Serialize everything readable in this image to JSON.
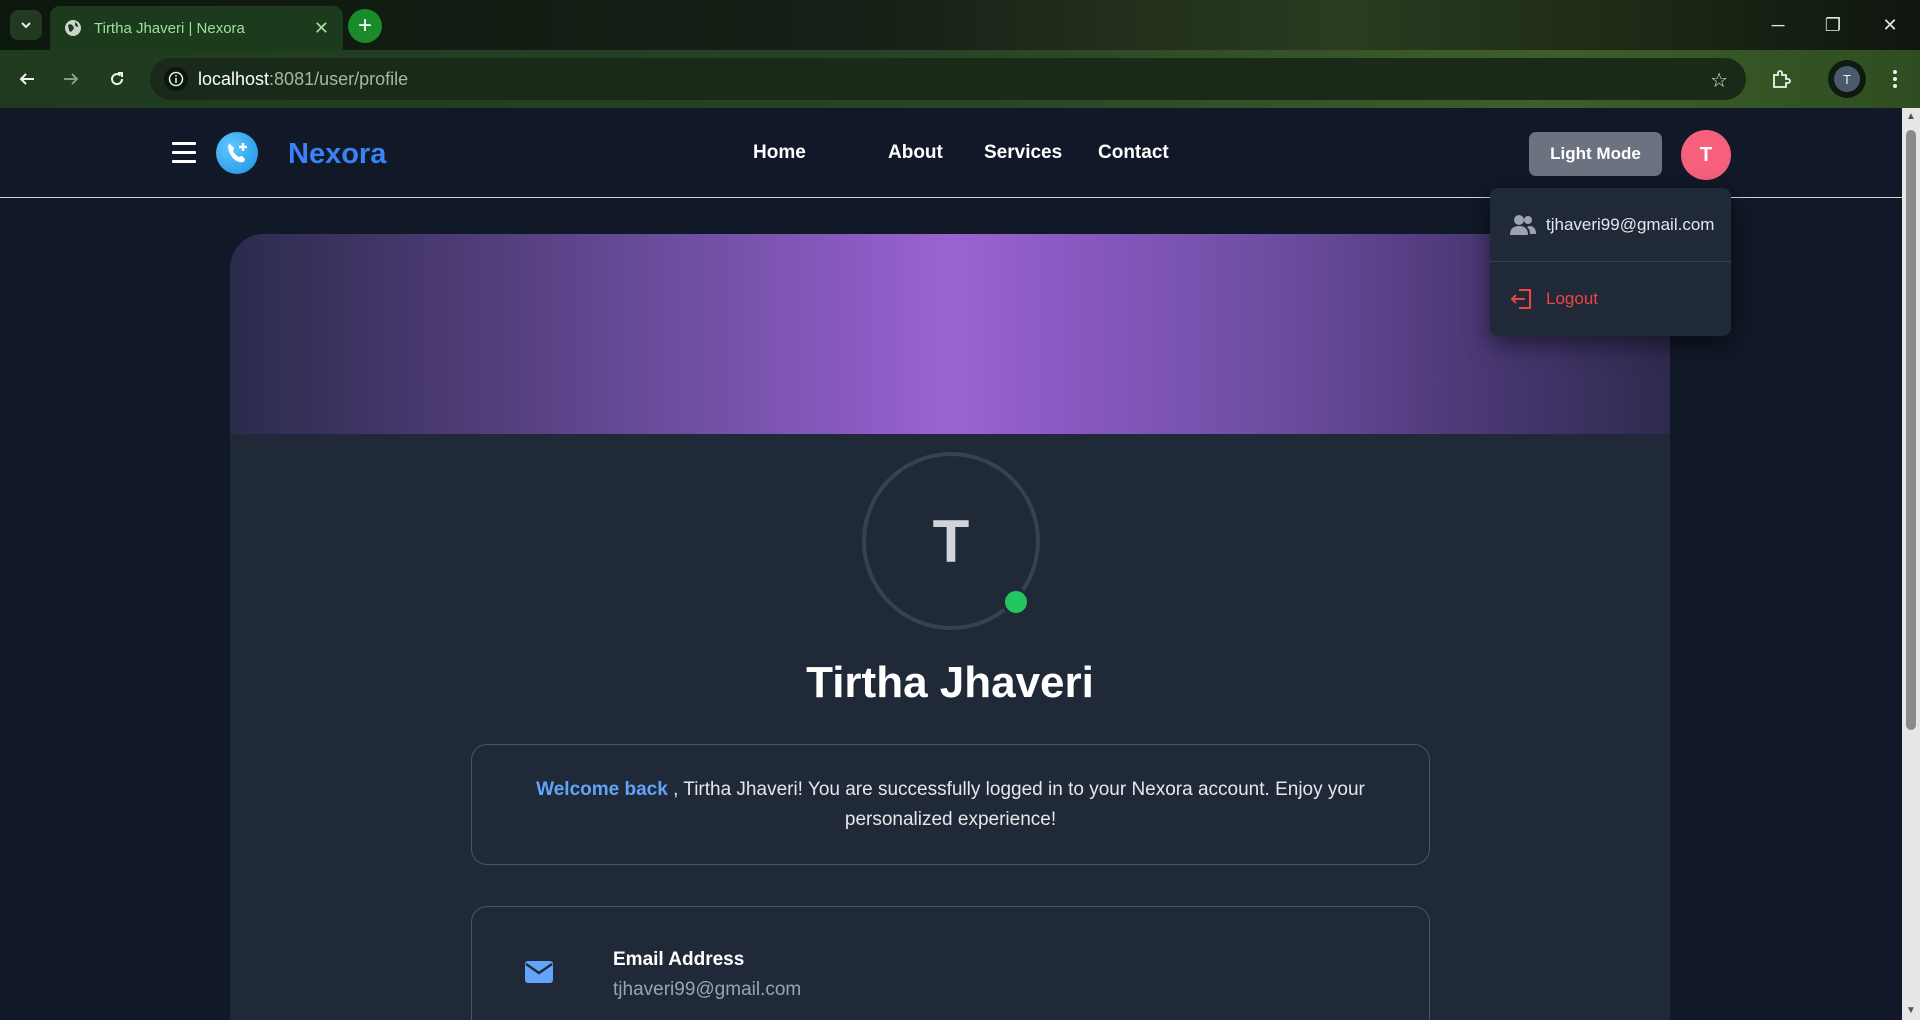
{
  "browser": {
    "tab_title": "Tirtha Jhaveri | Nexora",
    "url_host": "localhost",
    "url_path": ":8081/user/profile",
    "profile_initial": "T"
  },
  "site": {
    "brand": "Nexora",
    "nav": [
      "Home",
      "About",
      "Services",
      "Contact"
    ],
    "mode_button": "Light Mode",
    "avatar_initial": "T",
    "accent_color": "#3b82f6",
    "avatar_color": "#f6607a"
  },
  "dropdown": {
    "email": "tjhaveri99@gmail.com",
    "logout": "Logout"
  },
  "profile": {
    "initial": "T",
    "name": "Tirtha Jhaveri",
    "welcome_highlight": "Welcome back",
    "welcome_rest": " , Tirtha Jhaveri! You are successfully logged in to your Nexora account. Enjoy your personalized experience!",
    "email_label": "Email Address",
    "email_value": "tjhaveri99@gmail.com",
    "status": "online"
  }
}
